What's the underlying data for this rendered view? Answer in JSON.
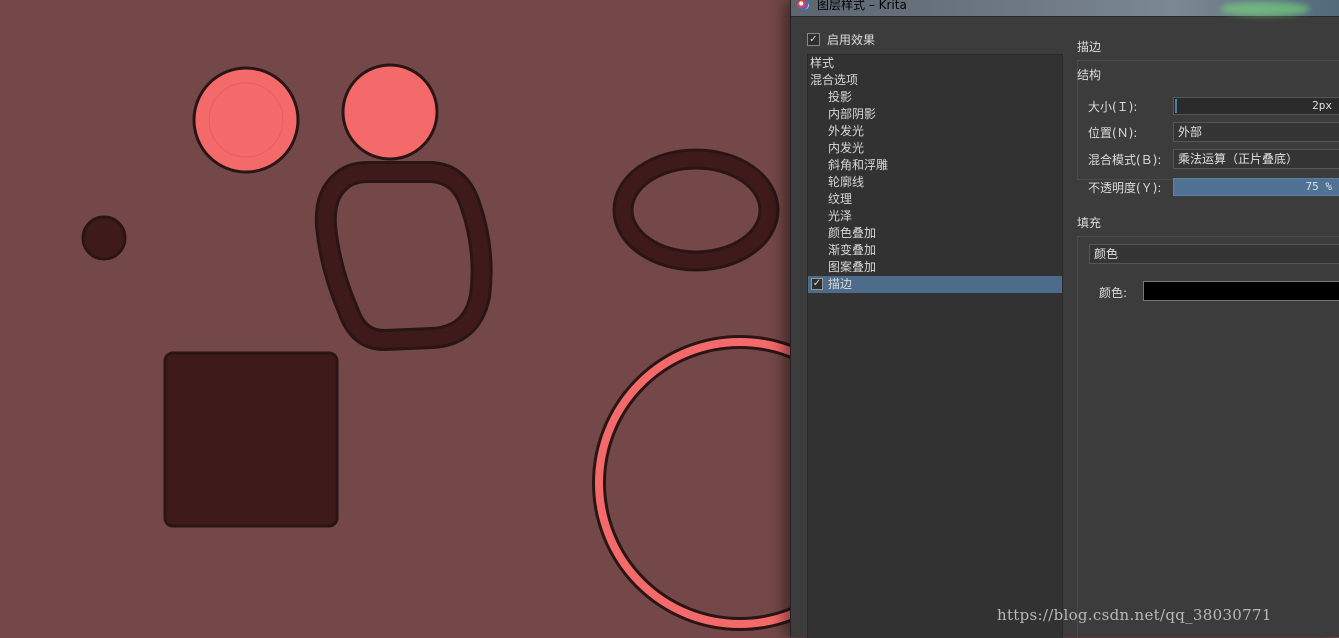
{
  "window": {
    "title": "图层样式 – Krita"
  },
  "canvas": {
    "background": "#744848",
    "accent_pink": "#f46a6a",
    "dark_fill": "#3f1a1a",
    "stroke": "#2a1515"
  },
  "enable_effects": {
    "label": "启用效果",
    "checked": true
  },
  "style_list": [
    {
      "label": "样式",
      "indent": false,
      "checked": false,
      "selected": false
    },
    {
      "label": "混合选项",
      "indent": false,
      "checked": false,
      "selected": false
    },
    {
      "label": "投影",
      "indent": true,
      "checked": false,
      "selected": false
    },
    {
      "label": "内部阴影",
      "indent": true,
      "checked": false,
      "selected": false
    },
    {
      "label": "外发光",
      "indent": true,
      "checked": false,
      "selected": false
    },
    {
      "label": "内发光",
      "indent": true,
      "checked": false,
      "selected": false
    },
    {
      "label": "斜角和浮雕",
      "indent": true,
      "checked": false,
      "selected": false
    },
    {
      "label": "轮廓线",
      "indent": true,
      "checked": false,
      "selected": false
    },
    {
      "label": "纹理",
      "indent": true,
      "checked": false,
      "selected": false
    },
    {
      "label": "光泽",
      "indent": true,
      "checked": false,
      "selected": false
    },
    {
      "label": "颜色叠加",
      "indent": true,
      "checked": false,
      "selected": false
    },
    {
      "label": "渐变叠加",
      "indent": true,
      "checked": false,
      "selected": false
    },
    {
      "label": "图案叠加",
      "indent": true,
      "checked": false,
      "selected": false
    },
    {
      "label": "描边",
      "indent": true,
      "checked": true,
      "selected": true
    }
  ],
  "stroke_panel": {
    "title": "描边",
    "structure": {
      "title": "结构",
      "size_label": "大小(Ｉ):",
      "size_value": "2px",
      "position_label": "位置(Ｎ):",
      "position_value": "外部",
      "blend_label": "混合模式(Ｂ):",
      "blend_value": "乘法运算（正片叠底）",
      "opacity_label": "不透明度(Ｙ):",
      "opacity_value": "75 %"
    },
    "fill": {
      "title": "填充",
      "type_value": "颜色",
      "color_label": "颜色:",
      "color_value": "#000000"
    }
  },
  "watermark": "https://blog.csdn.net/qq_38030771"
}
